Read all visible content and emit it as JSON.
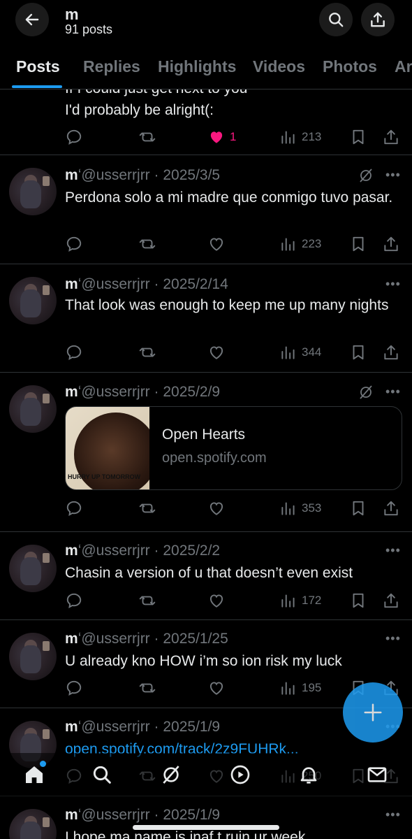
{
  "header": {
    "name": "m",
    "posts_count": "91 posts"
  },
  "tabs": [
    "Posts",
    "Replies",
    "Highlights",
    "Videos",
    "Photos",
    "Articles"
  ],
  "feed": {
    "partial_post": {
      "text_line_cut": "If I could just get next to you",
      "text_line": "I'd probably be alright(:",
      "likes": "1",
      "views": "213"
    },
    "posts": [
      {
        "name": "m",
        "verified_mark": "ʻ",
        "handle": "@usserrjrr",
        "date": "2025/3/5",
        "text": "Perdona solo a mi madre que conmigo tuvo pasar.",
        "views": "223"
      },
      {
        "name": "m",
        "verified_mark": "ʻ",
        "handle": "@usserrjrr",
        "date": "2025/2/14",
        "text": "That look was enough to keep me up many nights",
        "views": "344"
      },
      {
        "name": "m",
        "verified_mark": "ʻ",
        "handle": "@usserrjrr",
        "date": "2025/2/9",
        "card_title": "Open Hearts",
        "card_domain": "open.spotify.com",
        "album_caption": "HURRY UP TOMORROW",
        "views": "353"
      },
      {
        "name": "m",
        "verified_mark": "ʻ",
        "handle": "@usserrjrr",
        "date": "2025/2/2",
        "text": "Chasin a version of u that doesn’t even exist",
        "views": "172"
      },
      {
        "name": "m",
        "verified_mark": "ʻ",
        "handle": "@usserrjrr",
        "date": "2025/1/25",
        "text": "U already kno HOW i’m so ion risk my luck",
        "views": "195"
      },
      {
        "name": "m",
        "verified_mark": "ʻ",
        "handle": "@usserrjrr",
        "date": "2025/1/9",
        "link": "open.spotify.com/track/2z9FUHRk...",
        "views": "250"
      },
      {
        "name": "m",
        "verified_mark": "ʻ",
        "handle": "@usserrjrr",
        "date": "2025/1/9",
        "text": "I hope ma name is inaf t ruin ur week"
      }
    ]
  },
  "colors": {
    "accent": "#1d9bf0",
    "like": "#f91880",
    "muted": "#71767b",
    "text": "#e7e9ea",
    "background": "#000000"
  },
  "icons": [
    "back-arrow-icon",
    "search-icon",
    "share-icon",
    "reply-icon",
    "repost-icon",
    "like-icon",
    "views-icon",
    "bookmark-icon",
    "grok-icon",
    "more-icon",
    "plus-icon",
    "home-icon",
    "explore-icon",
    "media-icon",
    "notifications-icon",
    "messages-icon"
  ]
}
